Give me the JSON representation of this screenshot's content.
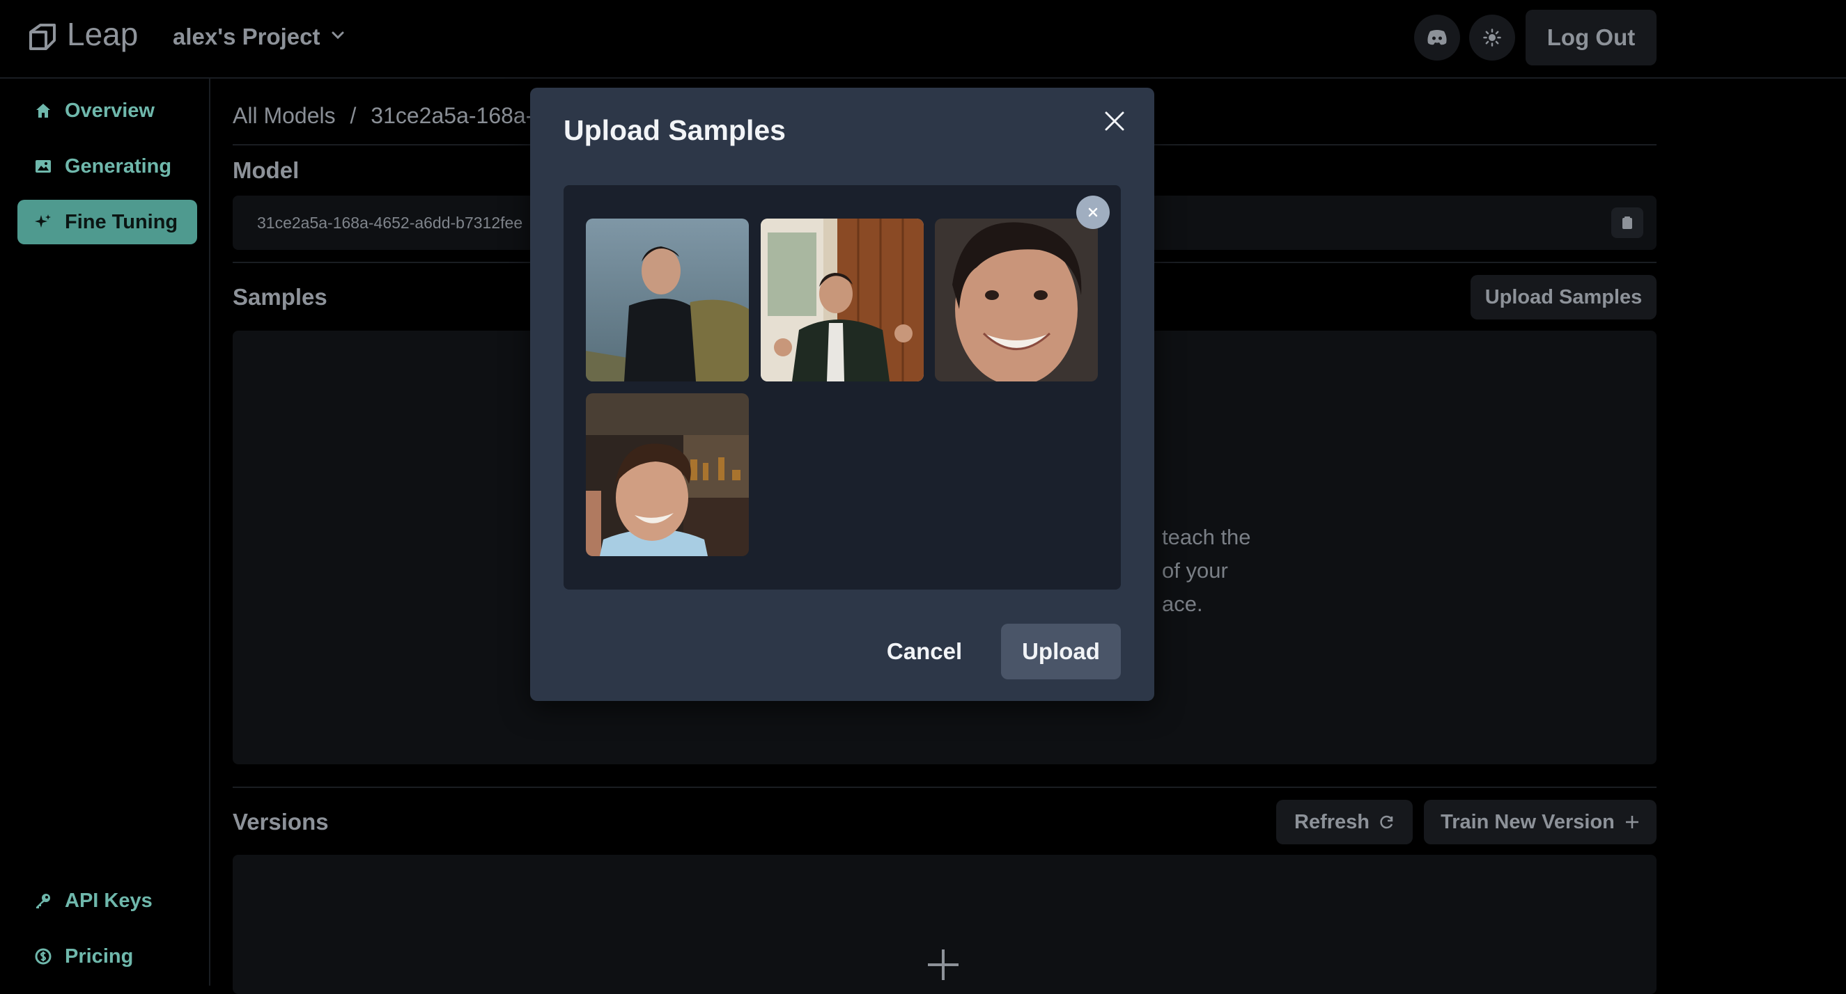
{
  "header": {
    "logo_text": "Leap",
    "project_name": "alex's Project",
    "logout_label": "Log Out"
  },
  "sidebar": {
    "items": [
      {
        "label": "Overview",
        "icon": "home-icon"
      },
      {
        "label": "Generating",
        "icon": "image-icon"
      },
      {
        "label": "Fine Tuning",
        "icon": "sparkles-icon",
        "active": true
      }
    ],
    "bottom_items": [
      {
        "label": "API Keys",
        "icon": "key-icon"
      },
      {
        "label": "Pricing",
        "icon": "dollar-icon"
      }
    ]
  },
  "main": {
    "breadcrumb_root": "All Models",
    "breadcrumb_sep": "/",
    "breadcrumb_current": "31ce2a5a-168a-4",
    "model_title": "Model",
    "model_id": "31ce2a5a-168a-4652-a6dd-b7312fee",
    "samples_title": "Samples",
    "upload_samples_label": "Upload Samples",
    "samples_hint_text": "teach the\nof your\nace.",
    "versions_title": "Versions",
    "refresh_label": "Refresh",
    "train_label": "Train New Version"
  },
  "modal": {
    "title": "Upload Samples",
    "cancel_label": "Cancel",
    "upload_label": "Upload",
    "thumbnail_count": 4
  },
  "colors": {
    "accent": "#4f9a8f",
    "modal_bg": "#2d3748",
    "dropzone_bg": "#1a202c"
  }
}
